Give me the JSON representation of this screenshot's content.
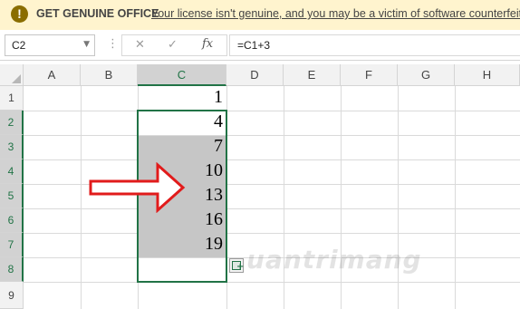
{
  "warning": {
    "icon": "warning-icon",
    "title": "GET GENUINE OFFICE",
    "message": "Your license isn't genuine, and you may be a victim of software counterfeiting"
  },
  "formula_bar": {
    "name_box": "C2",
    "cancel_icon": "cancel-icon",
    "enter_icon": "check-icon",
    "fx_label": "fx",
    "formula": "=C1+3"
  },
  "columns": [
    "A",
    "B",
    "C",
    "D",
    "E",
    "F",
    "G",
    "H"
  ],
  "rows": [
    "1",
    "2",
    "3",
    "4",
    "5",
    "6",
    "7",
    "8",
    "9"
  ],
  "cells": {
    "C1": "1",
    "C2": "4",
    "C3": "7",
    "C4": "10",
    "C5": "13",
    "C6": "16",
    "C7": "19"
  },
  "selected_column": "C",
  "selected_rows": [
    "2",
    "3",
    "4",
    "5",
    "6",
    "7",
    "8"
  ],
  "selection_range": "C2:C8",
  "colors": {
    "accent": "#217346",
    "warning_bg": "#fff4ce",
    "arrow": "#e11b1b"
  },
  "overlay": {
    "arrow_icon": "right-arrow-icon",
    "watermark": "uantrimang"
  }
}
